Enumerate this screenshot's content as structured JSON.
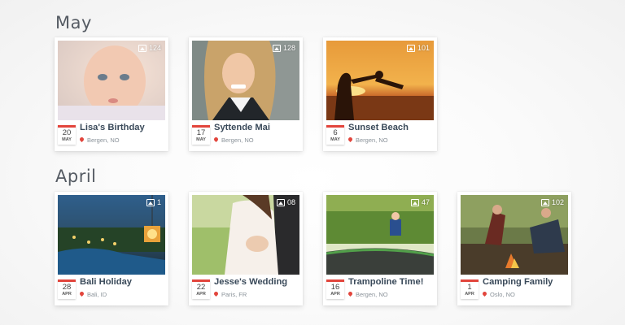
{
  "sections": [
    {
      "heading": "May",
      "cards": [
        {
          "count": "124",
          "day": "20",
          "month": "MAY",
          "title": "Lisa's Birthday",
          "location": "Bergen, NO"
        },
        {
          "count": "128",
          "day": "17",
          "month": "MAY",
          "title": "Syttende Mai",
          "location": "Bergen, NO"
        },
        {
          "count": "101",
          "day": "6",
          "month": "MAY",
          "title": "Sunset Beach",
          "location": "Bergen, NO"
        }
      ]
    },
    {
      "heading": "April",
      "cards": [
        {
          "count": "1",
          "day": "28",
          "month": "APR",
          "title": "Bali Holiday",
          "location": "Bali, ID"
        },
        {
          "count": "08",
          "day": "22",
          "month": "APR",
          "title": "Jesse's Wedding",
          "location": "Paris, FR"
        },
        {
          "count": "47",
          "day": "16",
          "month": "APR",
          "title": "Trampoline Time!",
          "location": "Bergen, NO"
        },
        {
          "count": "102",
          "day": "1",
          "month": "APR",
          "title": "Camping Family",
          "location": "Oslo, NO"
        }
      ]
    }
  ],
  "colors": {
    "accent": "#e2453c",
    "title_text": "#3a4a5a",
    "heading_text": "#555b63"
  }
}
